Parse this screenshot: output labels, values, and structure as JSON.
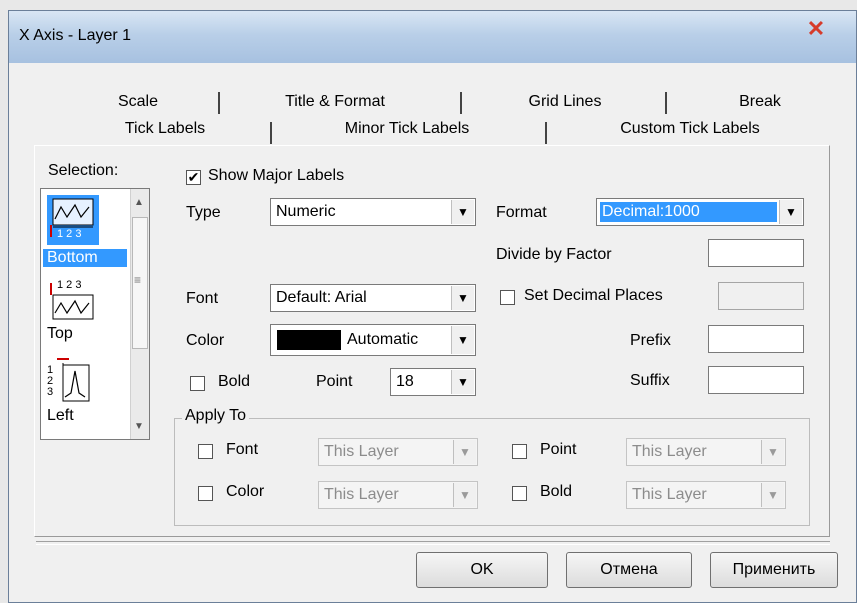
{
  "window": {
    "title": "X Axis - Layer 1",
    "close_glyph": "✕"
  },
  "tabs_back": [
    "Scale",
    "Title & Format",
    "Grid Lines",
    "Break"
  ],
  "tabs_front": [
    "Tick Labels",
    "Minor Tick Labels",
    "Custom Tick Labels"
  ],
  "selection": {
    "label": "Selection:",
    "items": [
      {
        "label": "Bottom",
        "icon": "axis-bottom-icon",
        "glyph": "1 2 3",
        "selected": true
      },
      {
        "label": "Top",
        "icon": "axis-top-icon",
        "glyph": "1 2 3",
        "selected": false
      },
      {
        "label": "Left",
        "icon": "axis-left-icon",
        "glyph": "1 2 3",
        "selected": false
      }
    ]
  },
  "show_major": {
    "label": "Show Major Labels",
    "checked": true,
    "mark": "✔"
  },
  "type": {
    "label": "Type",
    "value": "Numeric"
  },
  "format": {
    "label": "Format",
    "value": "Decimal:1000"
  },
  "divide": {
    "label": "Divide by Factor",
    "value": ""
  },
  "font": {
    "label": "Font",
    "value": "Default: Arial"
  },
  "set_decimal": {
    "label": "Set Decimal Places",
    "checked": false,
    "value": ""
  },
  "color": {
    "label": "Color",
    "value": "Automatic",
    "swatch": "#000000"
  },
  "prefix": {
    "label": "Prefix",
    "value": ""
  },
  "suffix": {
    "label": "Suffix",
    "value": ""
  },
  "bold": {
    "label": "Bold",
    "checked": false
  },
  "point": {
    "label": "Point",
    "value": "18"
  },
  "apply_to": {
    "title": "Apply To",
    "font": {
      "label": "Font",
      "value": "This Layer"
    },
    "color": {
      "label": "Color",
      "value": "This Layer"
    },
    "point": {
      "label": "Point",
      "value": "This Layer"
    },
    "bold": {
      "label": "Bold",
      "value": "This Layer"
    }
  },
  "buttons": {
    "ok": "OK",
    "cancel": "Отмена",
    "apply": "Применить"
  },
  "dropdown_glyph": "▼",
  "scroll_up": "▲",
  "scroll_down": "▼",
  "scroll_grip": "≡"
}
